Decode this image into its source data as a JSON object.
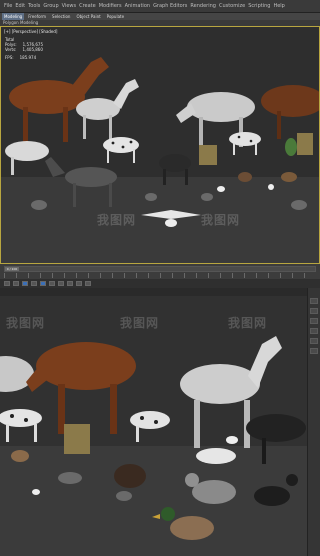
{
  "top": {
    "menubar": [
      "File",
      "Edit",
      "Tools",
      "Group",
      "Views",
      "Create",
      "Modifiers",
      "Animation",
      "Graph Editors",
      "Rendering",
      "Customize",
      "Scripting",
      "Help"
    ],
    "ribbon_tabs": [
      {
        "label": "Modeling",
        "active": true
      },
      {
        "label": "Freeform",
        "active": false
      },
      {
        "label": "Selection",
        "active": false
      },
      {
        "label": "Object Paint",
        "active": false
      },
      {
        "label": "Populate",
        "active": false
      }
    ],
    "sub_label": "Polygon Modeling",
    "viewport_label": "[+] [Perspective] [Shaded]",
    "stats": {
      "header": "Total",
      "rows": [
        {
          "label": "Polys:",
          "value": "1,576,675"
        },
        {
          "label": "Verts:",
          "value": "1,405,860"
        },
        {
          "label": "FPS:",
          "value": "185.974"
        }
      ]
    },
    "timeline_thumb": "0 / 100"
  },
  "watermark": "我图网",
  "colors": {
    "viewport_border": "#b8a640",
    "active_tab": "#5e6f86",
    "horse_brown": "#7b3e1c",
    "horse_white": "#c9c9c9",
    "dog_spotted": "#e5e5e5"
  }
}
